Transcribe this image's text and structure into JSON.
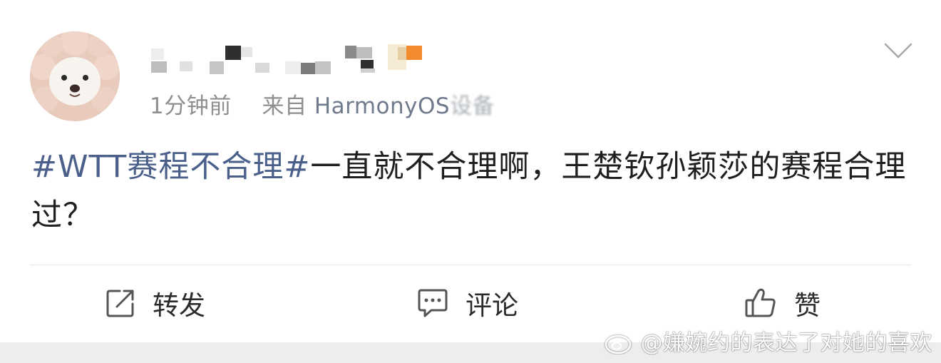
{
  "post": {
    "time": "1分钟前",
    "source_prefix": "来自",
    "source_device_visible": "HarmonyOS",
    "source_device_blurred": "设备",
    "topic": "#WTT赛程不合理#",
    "content": "一直就不合理啊，王楚钦孙颖莎的赛程合理过？"
  },
  "actions": {
    "repost_label": "转发",
    "comment_label": "评论",
    "like_label": "赞"
  },
  "watermark": {
    "text": "@嫌婉约的表达了对她的喜欢"
  },
  "icons": {
    "menu": "chevron-down-icon",
    "repost": "repost-icon",
    "comment": "comment-icon",
    "like": "thumbs-up-icon",
    "watermark_logo": "weibo-logo-icon"
  },
  "colors": {
    "topic": "#4a5f8a",
    "meta": "#8f8f8f",
    "accent_orange": "#f28a2e"
  }
}
